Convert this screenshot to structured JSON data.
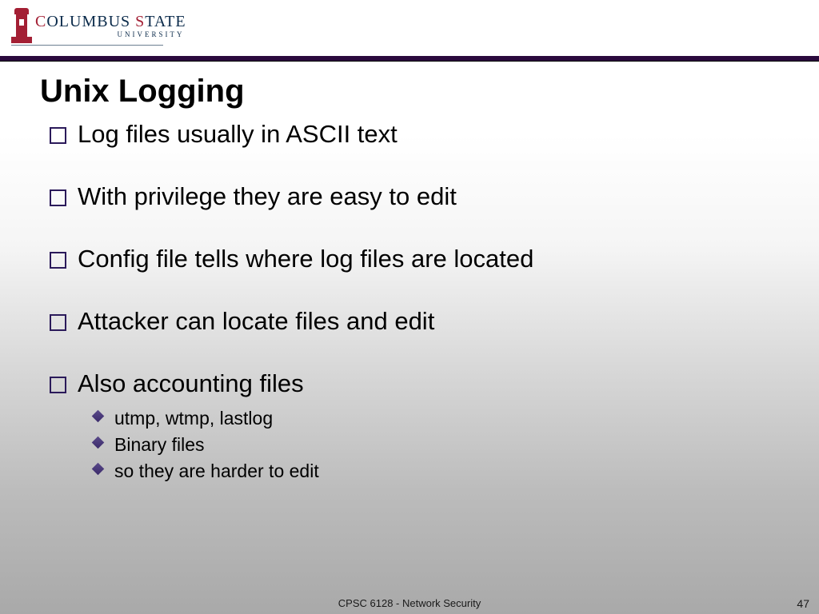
{
  "logo": {
    "line1_a": "C",
    "line1_b": "OLUMBUS ",
    "line1_c": "S",
    "line1_d": "TATE",
    "sub": "UNIVERSITY"
  },
  "title": "Unix Logging",
  "bullets": [
    "Log files usually in ASCII text",
    "With privilege they are easy to edit",
    "Config file tells where log files are located",
    "Attacker can locate files and edit",
    "Also accounting files"
  ],
  "subbullets": [
    "utmp, wtmp, lastlog",
    "Binary files",
    "so they are harder to edit"
  ],
  "footer": {
    "center": "CPSC 6128 - Network Security",
    "num": "47"
  }
}
